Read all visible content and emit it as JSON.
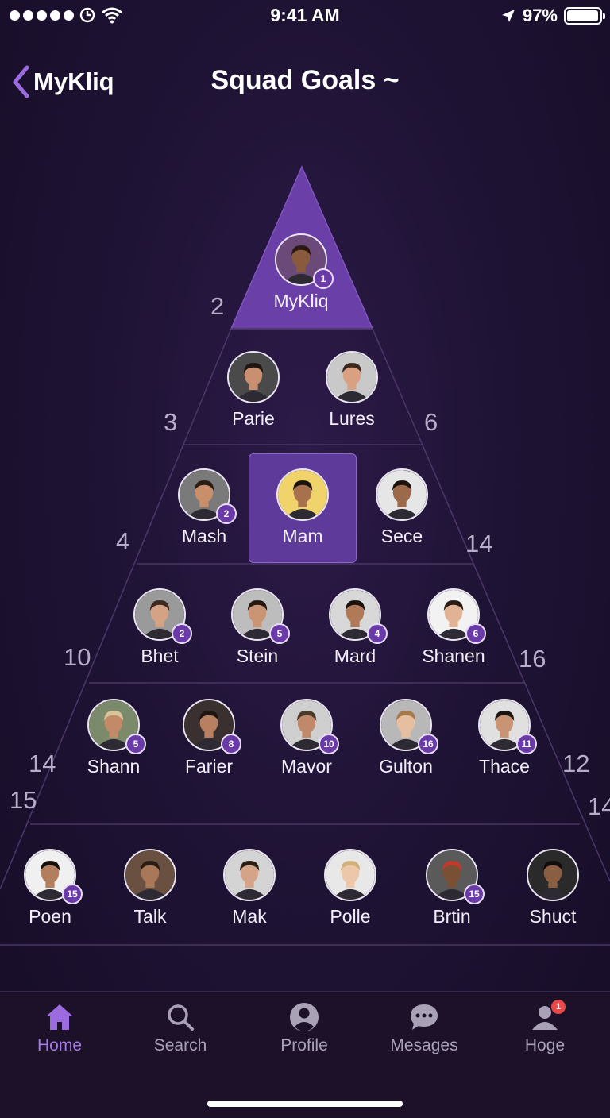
{
  "status_bar": {
    "time": "9:41 AM",
    "battery": "97%",
    "battery_level": 0.97,
    "signal_dots": 5
  },
  "nav": {
    "back_label": "MyKliq",
    "title": "Squad Goals ~"
  },
  "colors": {
    "accent": "#a57ae6",
    "highlight": "#5e3a9a",
    "badge": "#6a3aa8",
    "background": "#1f1335",
    "notification": "#e84848"
  },
  "pyramid": {
    "apex": {
      "name": "MyKliq",
      "badge": "1",
      "skin": "#8a5a3c",
      "hair": "#2b1a10",
      "bg": "#6b4a7a"
    },
    "rows": [
      [
        {
          "name": "Parie",
          "badge": "",
          "skin": "#c89070",
          "hair": "#1e1612",
          "bg": "#4a4a4a"
        },
        {
          "name": "Lures",
          "badge": "",
          "skin": "#d9a182",
          "hair": "#3a2a20",
          "bg": "#c9c9c9"
        }
      ],
      [
        {
          "name": "Mash",
          "badge": "2",
          "skin": "#c98f6a",
          "hair": "#2a1d15",
          "bg": "#7a7a7a"
        },
        {
          "name": "Mam",
          "badge": "",
          "skin": "#a8714e",
          "hair": "#1a120c",
          "bg": "#f0d36a",
          "selected": true
        },
        {
          "name": "Sece",
          "badge": "",
          "skin": "#9b6a4a",
          "hair": "#1b120d",
          "bg": "#e6e6e6"
        }
      ],
      [
        {
          "name": "Bhet",
          "badge": "2",
          "skin": "#d4a285",
          "hair": "#3b2a20",
          "bg": "#9a9a9a"
        },
        {
          "name": "Stein",
          "badge": "5",
          "skin": "#c99574",
          "hair": "#241811",
          "bg": "#bdbdbd"
        },
        {
          "name": "Mard",
          "badge": "4",
          "skin": "#b07a58",
          "hair": "#1a120c",
          "bg": "#d8d8d8"
        },
        {
          "name": "Shanen",
          "badge": "6",
          "skin": "#e0b394",
          "hair": "#2a1c14",
          "bg": "#f2f2f2"
        }
      ],
      [
        {
          "name": "Shann",
          "badge": "5",
          "skin": "#c28a66",
          "hair": "#d8c49a",
          "bg": "#7a8a6a"
        },
        {
          "name": "Farier",
          "badge": "8",
          "skin": "#b88060",
          "hair": "#1e1510",
          "bg": "#3a3030"
        },
        {
          "name": "Mavor",
          "badge": "10",
          "skin": "#c08a6a",
          "hair": "#4a3a2a",
          "bg": "#cfcfcf"
        },
        {
          "name": "Gulton",
          "badge": "16",
          "skin": "#e6bfa0",
          "hair": "#a67a4a",
          "bg": "#b8b8b8"
        },
        {
          "name": "Thace",
          "badge": "11",
          "skin": "#c89474",
          "hair": "#1c140f",
          "bg": "#e0e0e0"
        }
      ],
      [
        {
          "name": "Poen",
          "badge": "15",
          "skin": "#b27e5e",
          "hair": "#15100c",
          "bg": "#f0f0f0"
        },
        {
          "name": "Talk",
          "badge": "",
          "skin": "#a87858",
          "hair": "#2a1d14",
          "bg": "#6a5040"
        },
        {
          "name": "Mak",
          "badge": "",
          "skin": "#d5a488",
          "hair": "#2a1e15",
          "bg": "#d4d4d4"
        },
        {
          "name": "Polle",
          "badge": "",
          "skin": "#ecc7aa",
          "hair": "#d2b07a",
          "bg": "#e8e8e8"
        },
        {
          "name": "Brtin",
          "badge": "15",
          "skin": "#7a5034",
          "hair": "#c0392b",
          "bg": "#5a5a5a"
        },
        {
          "name": "Shuct",
          "badge": "",
          "skin": "#8a5e42",
          "hair": "#120d0a",
          "bg": "#2a2a2a"
        }
      ]
    ],
    "side_numbers": {
      "left": [
        "2",
        "3",
        "4",
        "10",
        "14",
        "15"
      ],
      "right": [
        "6",
        "14",
        "16",
        "12",
        "14"
      ]
    }
  },
  "tabs": [
    {
      "label": "Home",
      "icon": "home-icon",
      "active": true
    },
    {
      "label": "Search",
      "icon": "search-icon"
    },
    {
      "label": "Profile",
      "icon": "profile-icon"
    },
    {
      "label": "Mesages",
      "icon": "messages-icon"
    },
    {
      "label": "Hoge",
      "icon": "person-notification-icon",
      "notification": "1"
    }
  ]
}
